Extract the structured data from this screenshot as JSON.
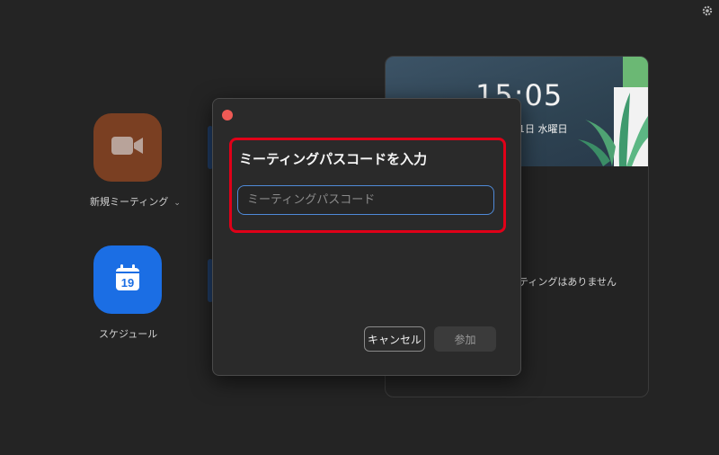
{
  "home": {
    "new_meeting_label": "新規ミーティング",
    "schedule_label": "スケジュール",
    "calendar_day": "19"
  },
  "panel": {
    "clock": "15:05",
    "date_fragment": "1日 水曜日",
    "no_meetings": "ティングはありません"
  },
  "dialog": {
    "title": "ミーティングパスコードを入力",
    "input_placeholder": "ミーティングパスコード",
    "input_value": "",
    "cancel_label": "キャンセル",
    "join_label": "参加"
  },
  "colors": {
    "highlight": "#e00018",
    "new_meeting_bg": "#7a3f22",
    "schedule_bg": "#1b6ee4",
    "input_focus": "#4f8ad8"
  },
  "icons": [
    "gear-icon",
    "video-camera-icon",
    "chevron-down-icon",
    "calendar-icon",
    "close-icon",
    "plant-illustration"
  ]
}
